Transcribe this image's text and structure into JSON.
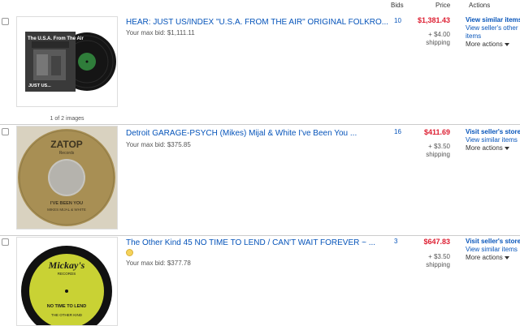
{
  "columns": {
    "bids": "Bids",
    "price": "Price",
    "actions": "Actions"
  },
  "items": [
    {
      "title": "HEAR: JUST US/INDEX \"U.S.A. FROM THE AIR\" ORIGINAL FOLKRO...",
      "maxbid_label": "Your max bid:",
      "maxbid_value": "$1,111.11",
      "bids": "10",
      "price": "$1,381.43",
      "shipping_amount": "+ $4.00",
      "shipping_label": "shipping",
      "thumb_caption": "1 of 2 images",
      "album_title": "The U.S.A. From The Air",
      "album_sub": "JUST US...",
      "actions": [
        "View similar items",
        "View seller's other items",
        "More actions"
      ]
    },
    {
      "title": "Detroit GARAGE-PSYCH (Mikes) Mijal & White I've Been You ...",
      "maxbid_label": "Your max bid:",
      "maxbid_value": "$375.85",
      "bids": "16",
      "price": "$411.69",
      "shipping_amount": "+ $3.50",
      "shipping_label": "shipping",
      "label_brand": "ZATOP",
      "label_sub": "Records",
      "label_song": "I'VE BEEN YOU",
      "label_artist": "MIKES MIJAL & WHITE",
      "actions": [
        "Visit seller's store",
        "View similar items",
        "More actions"
      ]
    },
    {
      "title": "The Other Kind 45 NO TIME TO LEND / CAN'T WAIT FOREVER ~ ...",
      "maxbid_label": "Your max bid:",
      "maxbid_value": "$377.78",
      "bids": "3",
      "price": "$647.83",
      "shipping_amount": "+ $3.50",
      "shipping_label": "shipping",
      "label_brand": "Mickay's",
      "label_sub": "RECORDS",
      "label_song": "NO TIME TO LEND",
      "label_artist": "THE OTHER KIND",
      "actions": [
        "Visit seller's store",
        "View similar items",
        "More actions"
      ]
    }
  ],
  "colors": {
    "link": "#0654ba",
    "price": "#dd1e31",
    "zatop_label": "#a88f54",
    "mickays_label": "#c9d234"
  }
}
